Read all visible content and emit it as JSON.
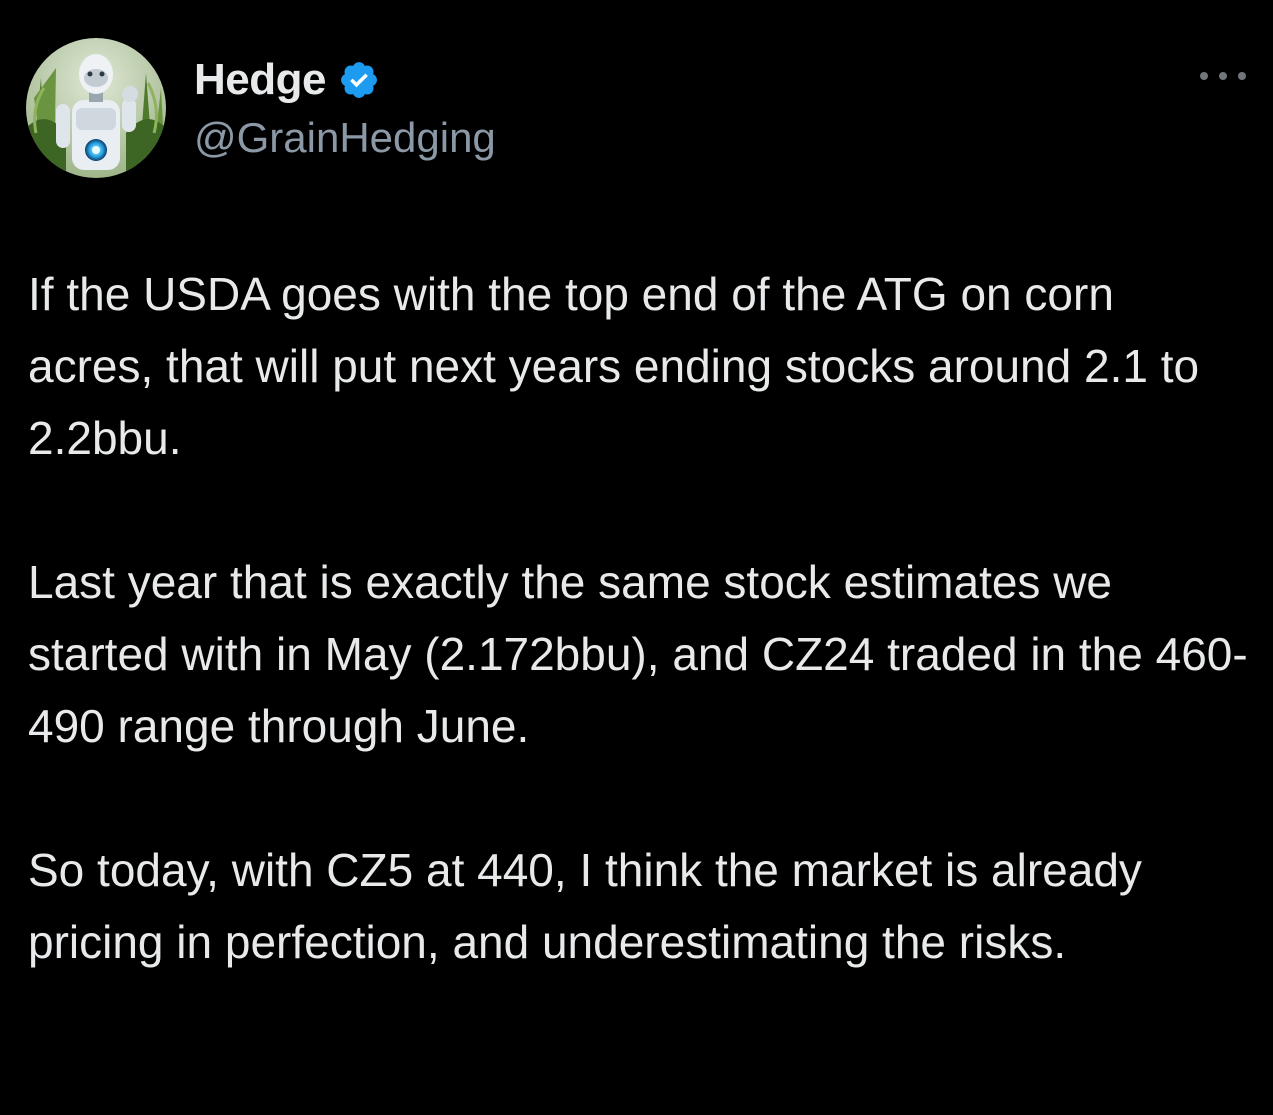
{
  "tweet": {
    "author": {
      "display_name": "Hedge",
      "handle": "@GrainHedging",
      "verified": true,
      "avatar_icon": "robot-in-cornfield-avatar",
      "verified_icon": "verified-badge-icon"
    },
    "more_icon": "more-options-icon",
    "paragraphs": [
      "If the USDA goes with the top end of the ATG on corn acres, that will put next years ending stocks around 2.1 to 2.2bbu.",
      "Last year that is exactly the same stock estimates we started with in May (2.172bbu), and CZ24 traded in the 460-490 range through June.",
      "So today, with CZ5 at 440, I think the market is already pricing in perfection, and underestimating the risks."
    ]
  },
  "colors": {
    "background": "#000000",
    "primary_text": "#e7e9ea",
    "secondary_text": "#8b98a5",
    "verified_blue": "#1d9bf0"
  }
}
